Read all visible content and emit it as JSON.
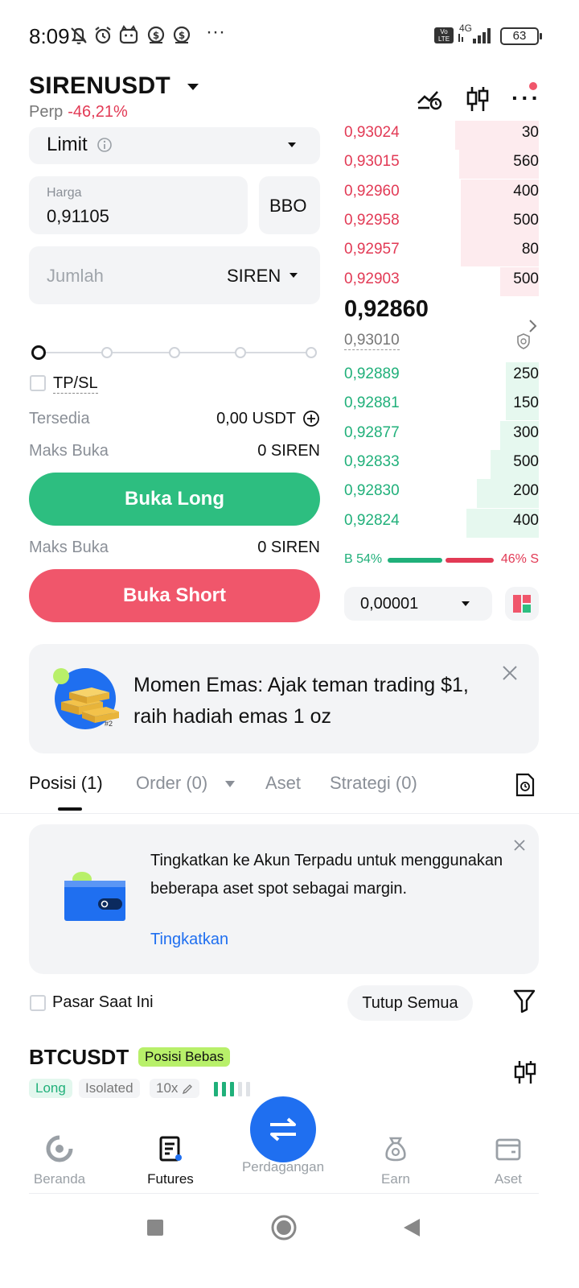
{
  "status_bar": {
    "time": "8:09",
    "network": "4G",
    "volte": "Vo LTE",
    "battery": "63",
    "more": "···"
  },
  "header": {
    "pair": "SIRENUSDT",
    "type": "Perp",
    "change": "-46,21%"
  },
  "form": {
    "order_type": "Limit",
    "price_label": "Harga",
    "price_value": "0,91105",
    "bbo_label": "BBO",
    "amount_placeholder": "Jumlah",
    "amount_unit": "SIREN",
    "tpsl_label": "TP/SL",
    "available_label": "Tersedia",
    "available_value": "0,00 USDT",
    "max_open_label": "Maks Buka",
    "max_open_long": "0 SIREN",
    "max_open_short": "0 SIREN",
    "long_button": "Buka Long",
    "short_button": "Buka Short"
  },
  "order_book": {
    "asks": [
      {
        "price": "0,93024",
        "qty": "30",
        "depth": 0.43
      },
      {
        "price": "0,93015",
        "qty": "560",
        "depth": 0.41
      },
      {
        "price": "0,92960",
        "qty": "400",
        "depth": 0.4
      },
      {
        "price": "0,92958",
        "qty": "500",
        "depth": 0.4
      },
      {
        "price": "0,92957",
        "qty": "80",
        "depth": 0.4
      },
      {
        "price": "0,92903",
        "qty": "500",
        "depth": 0.2
      }
    ],
    "last_price": "0,92860",
    "mark_price": "0,93010",
    "bids": [
      {
        "price": "0,92889",
        "qty": "250",
        "depth": 0.17
      },
      {
        "price": "0,92881",
        "qty": "150",
        "depth": 0.17
      },
      {
        "price": "0,92877",
        "qty": "300",
        "depth": 0.2
      },
      {
        "price": "0,92833",
        "qty": "500",
        "depth": 0.25
      },
      {
        "price": "0,92830",
        "qty": "200",
        "depth": 0.32
      },
      {
        "price": "0,92824",
        "qty": "400",
        "depth": 0.37
      }
    ],
    "buy_ratio": "B 54%",
    "sell_ratio": "46% S",
    "buy_fraction": 0.54,
    "precision": "0,00001"
  },
  "promo": {
    "text": "Momen Emas: Ajak teman trading $1, raih hadiah emas 1 oz",
    "badge": "#2"
  },
  "tabs": {
    "positions": "Posisi (1)",
    "orders": "Order (0)",
    "assets": "Aset",
    "strategies": "Strategi (0)"
  },
  "upgrade": {
    "text": "Tingkatkan ke Akun Terpadu untuk menggunakan beberapa aset spot sebagai margin.",
    "link": "Tingkatkan"
  },
  "filter": {
    "current_market": "Pasar Saat Ini",
    "close_all": "Tutup Semua"
  },
  "position": {
    "symbol": "BTCUSDT",
    "badge": "Posisi Bebas",
    "side": "Long",
    "margin_mode": "Isolated",
    "leverage": "10x"
  },
  "bottom_nav": {
    "home": "Beranda",
    "futures": "Futures",
    "trade": "Perdagangan",
    "earn": "Earn",
    "assets": "Aset"
  },
  "colors": {
    "green": "#2dbe80",
    "red": "#f0566b",
    "accent": "#1f6ff0"
  }
}
